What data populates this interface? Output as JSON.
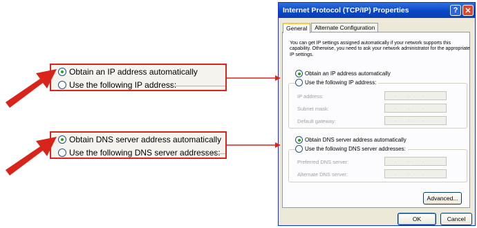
{
  "callouts": {
    "ip": {
      "auto_label": "Obtain an IP address automatically",
      "manual_label": "Use the following IP address:"
    },
    "dns": {
      "auto_label": "Obtain DNS server address automatically",
      "manual_label": "Use the following DNS server addresses:"
    }
  },
  "dialog": {
    "title": "Internet Protocol (TCP/IP) Properties",
    "help_glyph": "?",
    "close_glyph": "✕",
    "tabs": [
      "General",
      "Alternate Configuration"
    ],
    "intro": "You can get IP settings assigned automatically if your network supports this capability. Otherwise, you need to ask your network administrator for the appropriate IP settings.",
    "ip_auto": "Obtain an IP address automatically",
    "ip_manual": "Use the following IP address:",
    "ip_fields": [
      "IP address:",
      "Subnet mask:",
      "Default gateway:"
    ],
    "dns_auto": "Obtain DNS server address automatically",
    "dns_manual": "Use the following DNS server addresses:",
    "dns_fields": [
      "Preferred DNS server:",
      "Alternate DNS server:"
    ],
    "field_dots": "...",
    "advanced_label": "Advanced...",
    "ok_label": "OK",
    "cancel_label": "Cancel"
  },
  "colors": {
    "callout_border": "#d9241c",
    "arrow": "#d9241c",
    "title_bar": "#0a47c7",
    "radio_dot": "#21a121"
  },
  "icons": [
    "help-icon",
    "close-icon",
    "arrow-icon"
  ]
}
